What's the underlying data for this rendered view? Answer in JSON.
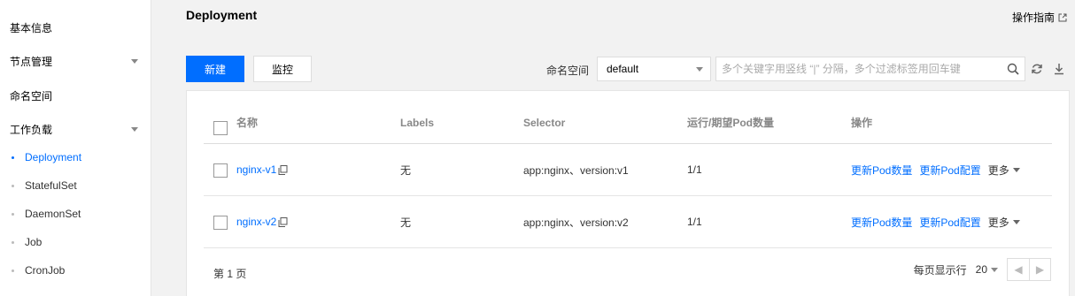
{
  "sidebar": {
    "items": [
      {
        "label": "基本信息"
      },
      {
        "label": "节点管理"
      },
      {
        "label": "命名空间"
      },
      {
        "label": "工作负载"
      }
    ],
    "sub_items": [
      {
        "label": "Deployment"
      },
      {
        "label": "StatefulSet"
      },
      {
        "label": "DaemonSet"
      },
      {
        "label": "Job"
      },
      {
        "label": "CronJob"
      }
    ]
  },
  "header": {
    "title": "Deployment",
    "guide_label": "操作指南"
  },
  "toolbar": {
    "create_label": "新建",
    "monitor_label": "监控",
    "namespace_label": "命名空间",
    "namespace_value": "default",
    "search_placeholder": "多个关键字用竖线 “|” 分隔，多个过滤标签用回车键"
  },
  "table": {
    "columns": [
      "名称",
      "Labels",
      "Selector",
      "运行/期望Pod数量",
      "操作"
    ],
    "rows": [
      {
        "name": "nginx-v1",
        "labels": "无",
        "selector": "app:nginx、version:v1",
        "run": "1/1",
        "op1": "更新Pod数量",
        "op2": "更新Pod配置",
        "more": "更多"
      },
      {
        "name": "nginx-v2",
        "labels": "无",
        "selector": "app:nginx、version:v2",
        "run": "1/1",
        "op1": "更新Pod数量",
        "op2": "更新Pod配置",
        "more": "更多"
      }
    ]
  },
  "footer": {
    "page_label": "第 1 页",
    "per_page_label": "每页显示行",
    "page_size": "20"
  },
  "colors": {
    "accent": "#006eff"
  }
}
